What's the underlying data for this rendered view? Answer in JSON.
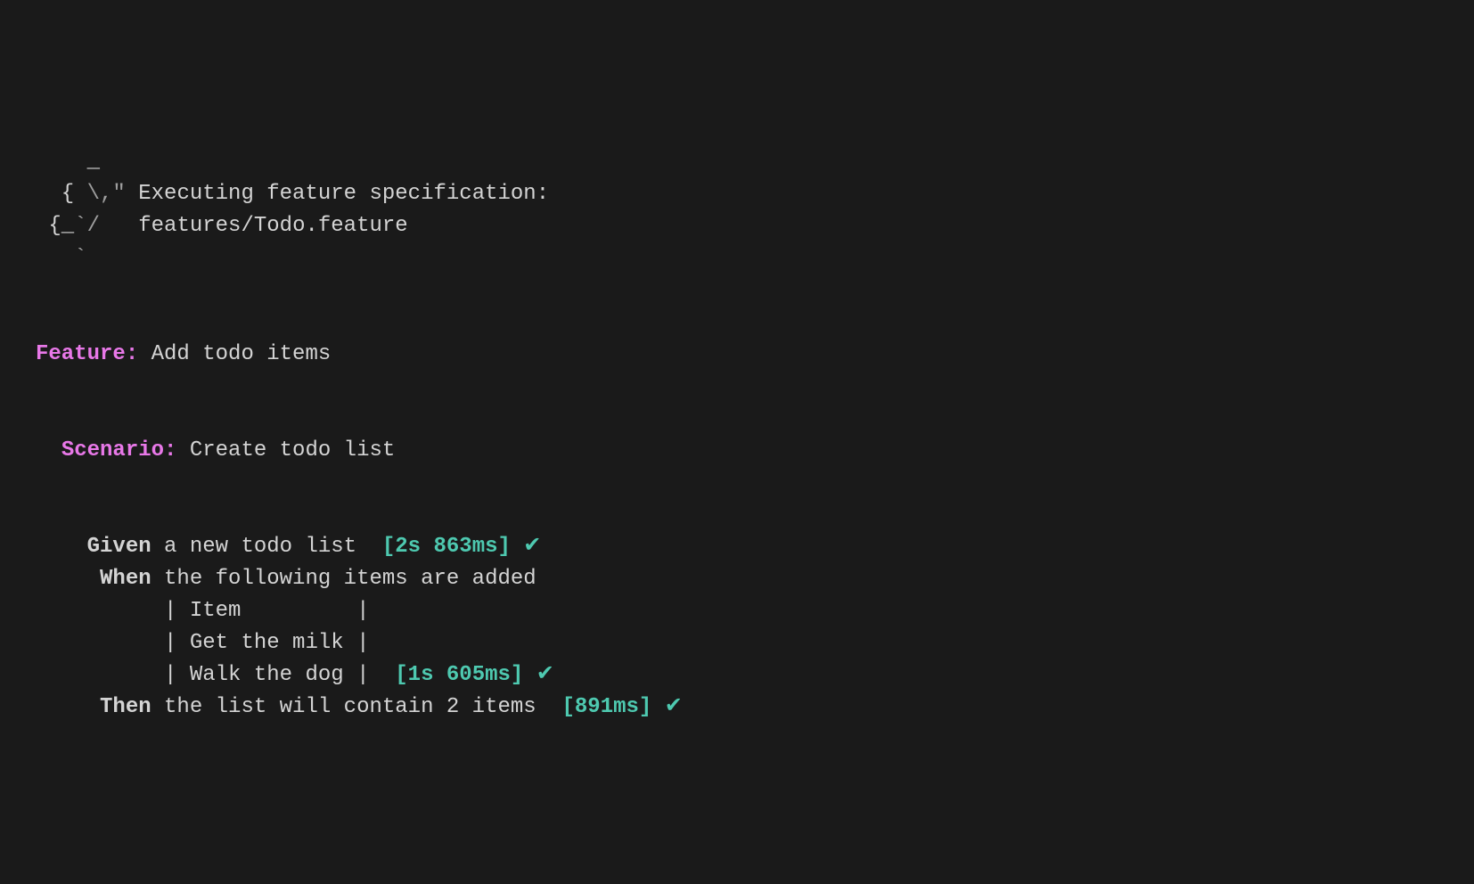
{
  "header": {
    "logo_line1": "    _",
    "logo_line2": "  {",
    "logo_line2b": " \\,\"",
    "logo_line2c": " Executing feature specification:",
    "logo_line3": " {_",
    "logo_line3b": "`/   ",
    "logo_line3c": "features/Todo.feature",
    "logo_line4": "   `"
  },
  "feature": {
    "keyword": "Feature:",
    "title": " Add todo items"
  },
  "scenario": {
    "keyword": "Scenario:",
    "title": " Create todo list"
  },
  "steps": {
    "given": {
      "keyword": "Given",
      "text": " a new todo list  ",
      "timing": "[2s 863ms]",
      "check": " ✔"
    },
    "when": {
      "keyword": "When",
      "text": " the following items are added",
      "table_row1": "| Item         |",
      "table_row2": "| Get the milk |",
      "table_row3": "| Walk the dog |  ",
      "timing": "[1s 605ms]",
      "check": " ✔"
    },
    "then": {
      "keyword": "Then",
      "text": " the list will contain 2 items  ",
      "timing": "[891ms]",
      "check": " ✔"
    }
  }
}
